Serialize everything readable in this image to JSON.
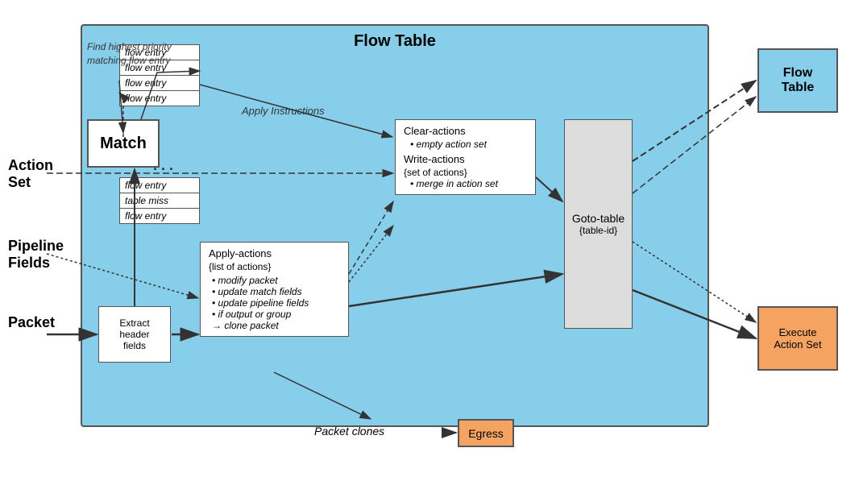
{
  "diagram": {
    "title": "Flow Table",
    "flow_entries": {
      "items": [
        "flow entry",
        "flow entry",
        "flow entry",
        "flow entry"
      ],
      "items2": [
        "flow entry",
        "table miss",
        "flow entry"
      ]
    },
    "match_box": {
      "label": "Match"
    },
    "annotation_find": "Find highest\npriority\nmatching\nflow entry",
    "annotation_apply": "Apply Instructions",
    "clear_write_box": {
      "title1": "Clear-actions",
      "item1": "• empty action set",
      "title2": "Write-actions",
      "subtitle2": "{set of actions}",
      "item2": "• merge in action set"
    },
    "apply_actions_box": {
      "title1": "Apply-actions",
      "subtitle1": "{list of actions}",
      "item1": "• modify packet",
      "item2": "• update match fields",
      "item3": "• update pipeline fields",
      "item4": "• if output or group",
      "item5": "→ clone packet"
    },
    "goto_table_box": {
      "line1": "Goto-table",
      "line2": "{table-id}"
    },
    "extract_box": {
      "text": "Extract\nheader\nfields"
    },
    "flow_table_right": {
      "line1": "Flow",
      "line2": "Table"
    },
    "execute_action_set": {
      "line1": "Execute",
      "line2": "Action Set"
    },
    "egress": "Egress",
    "left_labels": {
      "action_set": "Action\nSet",
      "pipeline_fields": "Pipeline\nFields",
      "packet": "Packet"
    },
    "packet_clones_label": "Packet clones"
  }
}
